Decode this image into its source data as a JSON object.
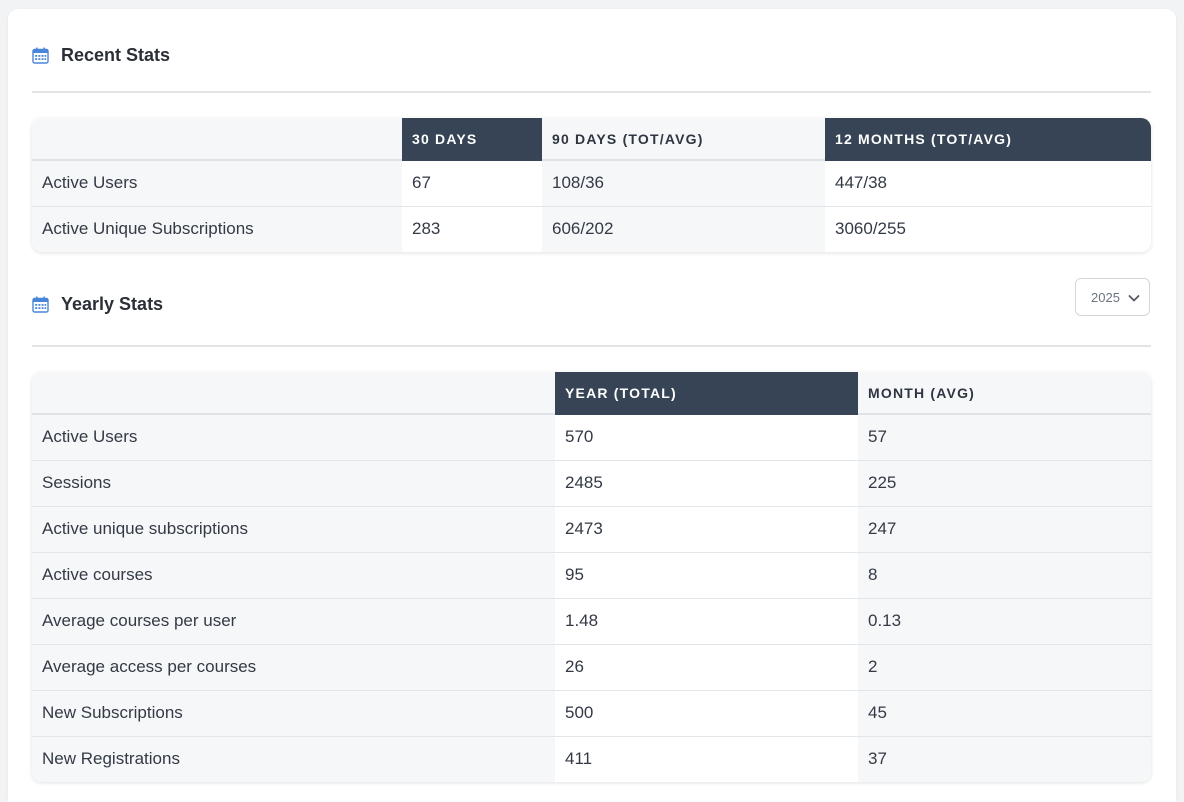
{
  "recent": {
    "title": "Recent Stats",
    "icon": "calendar-icon",
    "headers": [
      "",
      "30 DAYS",
      "90 DAYS (TOT/AVG)",
      "12 MONTHS (TOT/AVG)"
    ],
    "rows": [
      [
        "Active Users",
        "67",
        "108/36",
        "447/38"
      ],
      [
        "Active Unique Subscriptions",
        "283",
        "606/202",
        "3060/255"
      ]
    ]
  },
  "yearly": {
    "title": "Yearly Stats",
    "icon": "calendar-icon",
    "selected_year": "2025",
    "headers": [
      "",
      "YEAR (TOTAL)",
      "MONTH (AVG)"
    ],
    "rows": [
      [
        "Active Users",
        "570",
        "57"
      ],
      [
        "Sessions",
        "2485",
        "225"
      ],
      [
        "Active unique subscriptions",
        "2473",
        "247"
      ],
      [
        "Active courses",
        "95",
        "8"
      ],
      [
        "Average courses per user",
        "1.48",
        "0.13"
      ],
      [
        "Average access per courses",
        "26",
        "2"
      ],
      [
        "New Subscriptions",
        "500",
        "45"
      ],
      [
        "New Registrations",
        "411",
        "37"
      ]
    ]
  },
  "colors": {
    "header_dark": "#364455",
    "icon_blue": "#4a86d8"
  }
}
